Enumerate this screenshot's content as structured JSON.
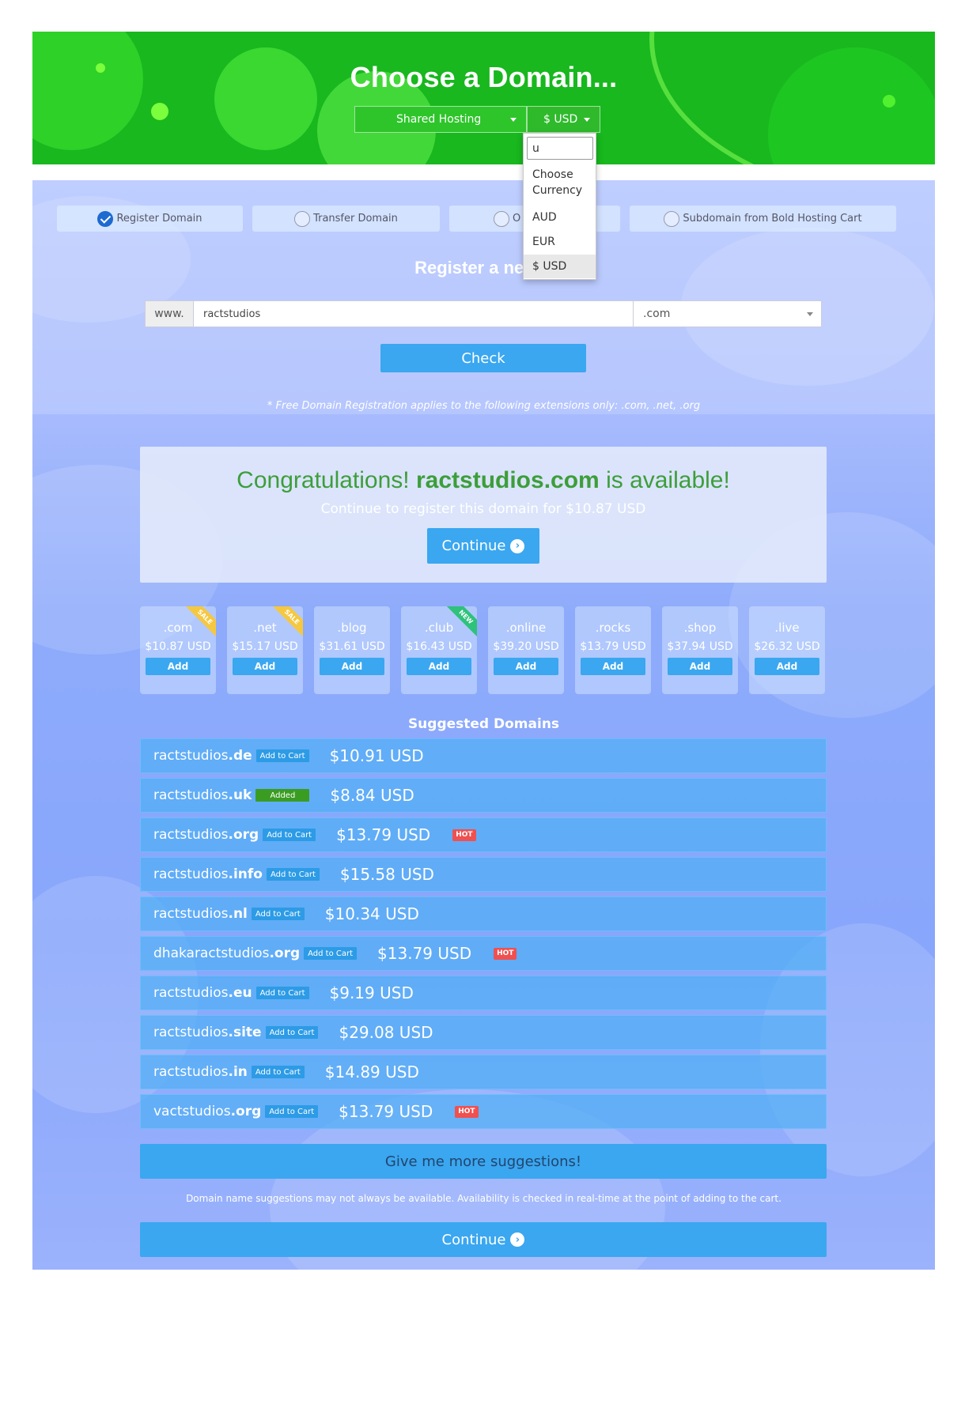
{
  "header": {
    "title": "Choose a Domain...",
    "product_select": "Shared Hosting",
    "currency_select": "$ USD"
  },
  "currency_dropdown": {
    "search_value": "u",
    "options": [
      "Choose Currency",
      "AUD",
      "EUR",
      "$ USD"
    ],
    "selected": "$ USD"
  },
  "tabs": [
    {
      "label": "Register Domain",
      "checked": true
    },
    {
      "label": "Transfer Domain",
      "checked": false
    },
    {
      "label": "O",
      "checked": false
    },
    {
      "label": "Subdomain from Bold Hosting Cart",
      "checked": false
    }
  ],
  "register": {
    "title": "Register a new d",
    "www_label": "www.",
    "domain_value": "ractstudios",
    "tld_value": ".com",
    "check_label": "Check",
    "free_note": "* Free Domain Registration applies to the following extensions only: .com, .net, .org"
  },
  "result": {
    "congrats_prefix": "Congratulations!",
    "domain": "ractstudios.com",
    "congrats_suffix": "is available!",
    "subtitle": "Continue to register this domain for $10.87 USD",
    "continue_label": "Continue"
  },
  "tld_cards": [
    {
      "tld": ".com",
      "price": "$10.87 USD",
      "add": "Add",
      "ribbon": "SALE"
    },
    {
      "tld": ".net",
      "price": "$15.17 USD",
      "add": "Add",
      "ribbon": "SALE"
    },
    {
      "tld": ".blog",
      "price": "$31.61 USD",
      "add": "Add",
      "ribbon": ""
    },
    {
      "tld": ".club",
      "price": "$16.43 USD",
      "add": "Add",
      "ribbon": "NEW"
    },
    {
      "tld": ".online",
      "price": "$39.20 USD",
      "add": "Add",
      "ribbon": ""
    },
    {
      "tld": ".rocks",
      "price": "$13.79 USD",
      "add": "Add",
      "ribbon": ""
    },
    {
      "tld": ".shop",
      "price": "$37.94 USD",
      "add": "Add",
      "ribbon": ""
    },
    {
      "tld": ".live",
      "price": "$26.32 USD",
      "add": "Add",
      "ribbon": ""
    }
  ],
  "suggestions": {
    "title": "Suggested Domains",
    "rows": [
      {
        "name": "ractstudios",
        "tld": ".de",
        "action": "Add to Cart",
        "price": "$10.91 USD",
        "hot": ""
      },
      {
        "name": "ractstudios",
        "tld": ".uk",
        "action": "Added",
        "price": "$8.84 USD",
        "hot": ""
      },
      {
        "name": "ractstudios",
        "tld": ".org",
        "action": "Add to Cart",
        "price": "$13.79 USD",
        "hot": "HOT"
      },
      {
        "name": "ractstudios",
        "tld": ".info",
        "action": "Add to Cart",
        "price": "$15.58 USD",
        "hot": ""
      },
      {
        "name": "ractstudios",
        "tld": ".nl",
        "action": "Add to Cart",
        "price": "$10.34 USD",
        "hot": ""
      },
      {
        "name": "dhakaractstudios",
        "tld": ".org",
        "action": "Add to Cart",
        "price": "$13.79 USD",
        "hot": "HOT"
      },
      {
        "name": "ractstudios",
        "tld": ".eu",
        "action": "Add to Cart",
        "price": "$9.19 USD",
        "hot": ""
      },
      {
        "name": "ractstudios",
        "tld": ".site",
        "action": "Add to Cart",
        "price": "$29.08 USD",
        "hot": ""
      },
      {
        "name": "ractstudios",
        "tld": ".in",
        "action": "Add to Cart",
        "price": "$14.89 USD",
        "hot": ""
      },
      {
        "name": "vactstudios",
        "tld": ".org",
        "action": "Add to Cart",
        "price": "$13.79 USD",
        "hot": "HOT"
      }
    ],
    "more_label": "Give me more suggestions!",
    "disclaimer": "Domain name suggestions may not always be available. Availability is checked in real-time at the point of adding to the cart.",
    "continue_label": "Continue"
  },
  "colors": {
    "header_green": "#18b81e",
    "accent_blue": "#3aa7f0",
    "success_green": "#3d9e3a",
    "hot_red": "#f05050",
    "sale_yellow": "#f5c842",
    "new_green": "#2ec27a"
  }
}
